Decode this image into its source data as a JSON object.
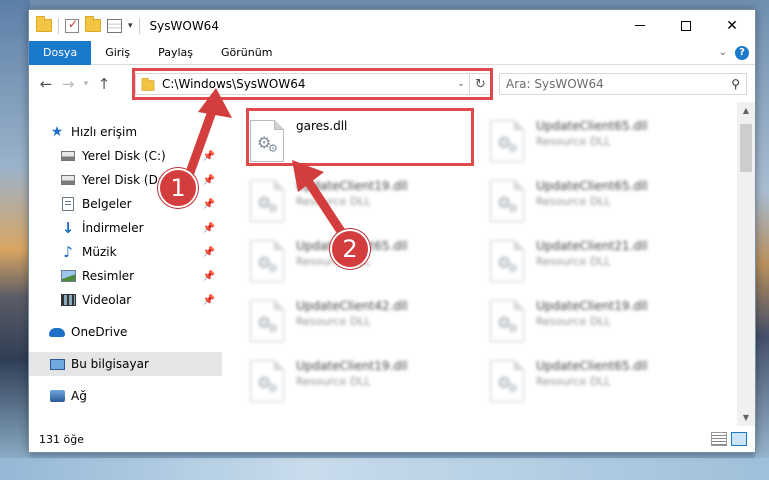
{
  "window": {
    "title": "SysWOW64"
  },
  "ribbon": {
    "tabs": [
      "Dosya",
      "Giriş",
      "Paylaş",
      "Görünüm"
    ]
  },
  "address_bar": {
    "path": "C:\\Windows\\SysWOW64"
  },
  "search": {
    "placeholder": "Ara: SysWOW64"
  },
  "nav_pane": {
    "items": [
      {
        "label": "Hızlı erişim",
        "icon": "star-icon"
      },
      {
        "label": "Yerel Disk (C:)",
        "icon": "drive-icon",
        "pinned": true
      },
      {
        "label": "Yerel Disk (D:)",
        "icon": "drive-icon",
        "pinned": true
      },
      {
        "label": "Belgeler",
        "icon": "documents-icon",
        "pinned": true
      },
      {
        "label": "İndirmeler",
        "icon": "download-icon",
        "pinned": true
      },
      {
        "label": "Müzik",
        "icon": "music-icon",
        "pinned": true
      },
      {
        "label": "Resimler",
        "icon": "pictures-icon",
        "pinned": true
      },
      {
        "label": "Videolar",
        "icon": "videos-icon",
        "pinned": true
      },
      {
        "label": "OneDrive",
        "icon": "onedrive-icon"
      },
      {
        "label": "Bu bilgisayar",
        "icon": "this-pc-icon",
        "selected": true
      },
      {
        "label": "Ağ",
        "icon": "network-icon"
      }
    ]
  },
  "files": [
    {
      "name": "gares.dll",
      "type": ""
    },
    {
      "name": "UpdateClient65.dll",
      "type": "Resource DLL"
    },
    {
      "name": "UpdateClient19.dll",
      "type": "Resource DLL"
    },
    {
      "name": "UpdateClient65.dll",
      "type": "Resource DLL"
    },
    {
      "name": "UpdateClient65.dll",
      "type": "Resource DLL"
    },
    {
      "name": "UpdateClient21.dll",
      "type": "Resource DLL"
    },
    {
      "name": "UpdateClient42.dll",
      "type": "Resource DLL"
    },
    {
      "name": "UpdateClient19.dll",
      "type": "Resource DLL"
    },
    {
      "name": "UpdateClient19.dll",
      "type": "Resource DLL"
    },
    {
      "name": "UpdateClient65.dll",
      "type": "Resource DLL"
    }
  ],
  "status": {
    "item_count": "131 öğe"
  },
  "callouts": {
    "step1": "1",
    "step2": "2"
  },
  "colors": {
    "accent": "#1979ca",
    "highlight": "#e04a4a"
  }
}
